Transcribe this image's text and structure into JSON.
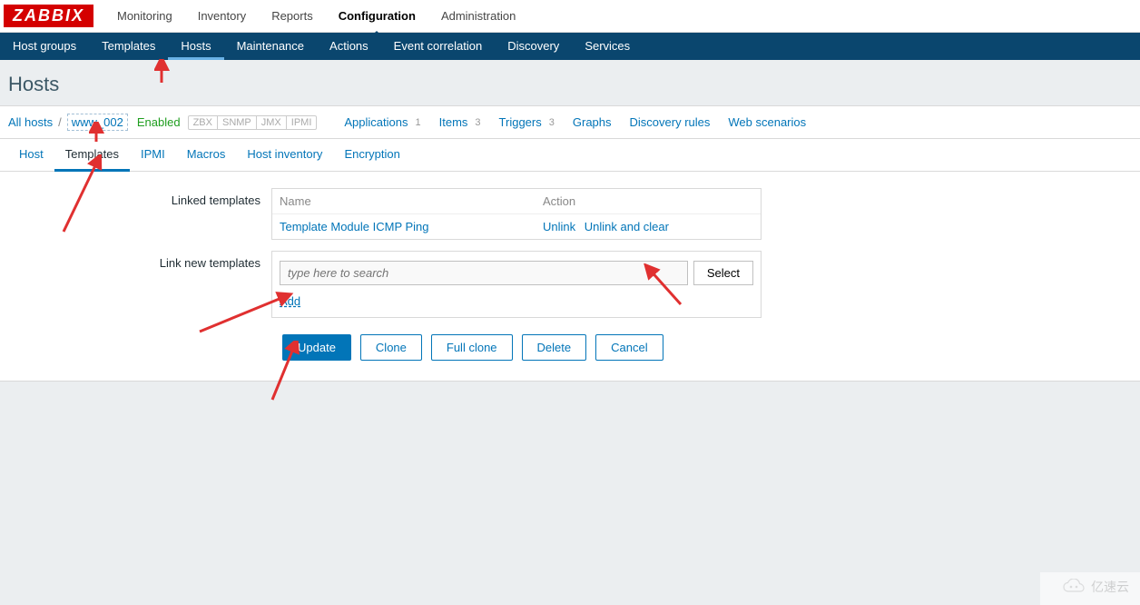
{
  "logo_text": "ZABBIX",
  "topnav": {
    "items": [
      "Monitoring",
      "Inventory",
      "Reports",
      "Configuration",
      "Administration"
    ],
    "active_index": 3
  },
  "subnav": {
    "items": [
      "Host groups",
      "Templates",
      "Hosts",
      "Maintenance",
      "Actions",
      "Event correlation",
      "Discovery",
      "Services"
    ],
    "active_index": 2
  },
  "page_title": "Hosts",
  "filterbar": {
    "all_hosts": "All hosts",
    "separator": "/",
    "hostname": "www_002",
    "enabled": "Enabled",
    "badges": [
      "ZBX",
      "SNMP",
      "JMX",
      "IPMI"
    ],
    "links": [
      {
        "label": "Applications",
        "count": "1"
      },
      {
        "label": "Items",
        "count": "3"
      },
      {
        "label": "Triggers",
        "count": "3"
      },
      {
        "label": "Graphs",
        "count": ""
      },
      {
        "label": "Discovery rules",
        "count": ""
      },
      {
        "label": "Web scenarios",
        "count": ""
      }
    ]
  },
  "tabs": {
    "items": [
      "Host",
      "Templates",
      "IPMI",
      "Macros",
      "Host inventory",
      "Encryption"
    ],
    "active_index": 1
  },
  "form": {
    "linked_label": "Linked templates",
    "linked_head_name": "Name",
    "linked_head_action": "Action",
    "linked_rows": [
      {
        "name": "Template Module ICMP Ping",
        "unlink": "Unlink",
        "unlink_clear": "Unlink and clear"
      }
    ],
    "link_new_label": "Link new templates",
    "search_placeholder": "type here to search",
    "select_btn": "Select",
    "add_link": "Add"
  },
  "buttons": {
    "update": "Update",
    "clone": "Clone",
    "full_clone": "Full clone",
    "delete": "Delete",
    "cancel": "Cancel"
  },
  "watermark": "亿速云"
}
